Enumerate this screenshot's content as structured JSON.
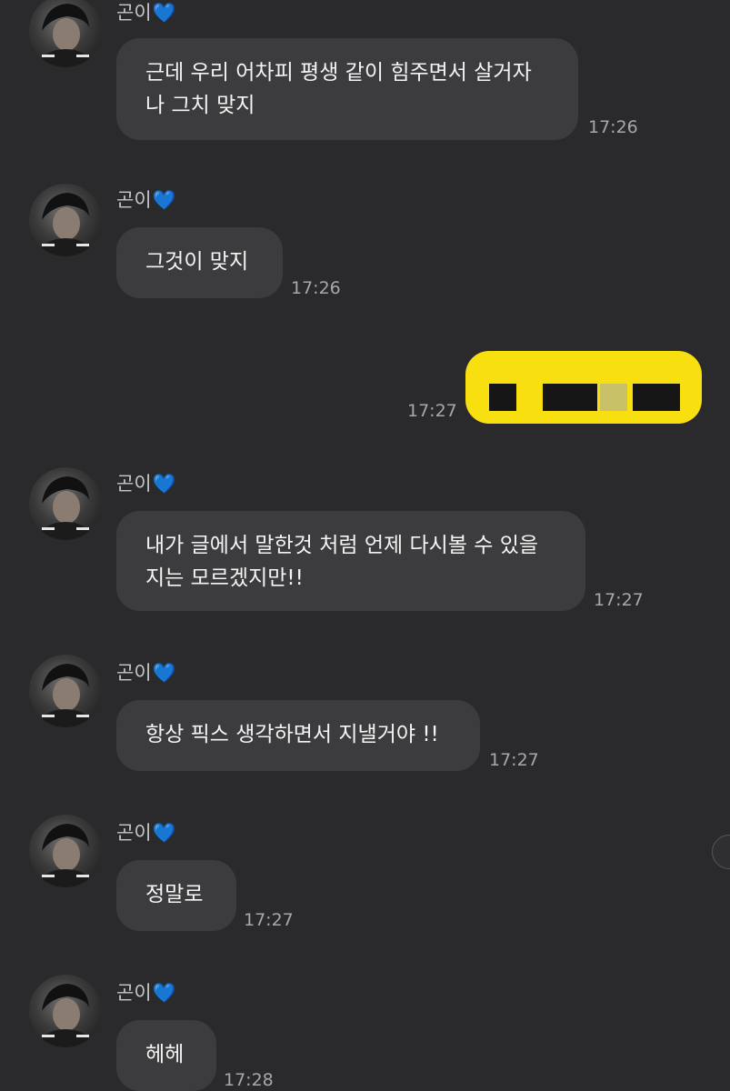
{
  "messages": [
    {
      "sender": "곤이",
      "heart": "💙",
      "lines": [
        "근데 우리 어차피 평생 같이 힘주면서 살거자",
        "나 그치 맞지"
      ],
      "time": "17:26"
    },
    {
      "sender": "곤이",
      "heart": "💙",
      "lines": [
        "그것이 맞지"
      ],
      "time": "17:26"
    },
    {
      "sender": "곤이",
      "heart": "💙",
      "lines": [
        "내가 글에서 말한것 처럼 언제 다시볼 수 있을",
        "지는 모르겠지만!!"
      ],
      "time": "17:27"
    },
    {
      "sender": "곤이",
      "heart": "💙",
      "lines": [
        "항상 픽스 생각하면서 지낼거야 !!"
      ],
      "time": "17:27"
    },
    {
      "sender": "곤이",
      "heart": "💙",
      "lines": [
        "정말로"
      ],
      "time": "17:27"
    },
    {
      "sender": "곤이",
      "heart": "💙",
      "lines": [
        "헤헤"
      ],
      "time": "17:28"
    }
  ],
  "my_message": {
    "time": "17:27",
    "redacted": true
  },
  "colors": {
    "background": "#2a2a2c",
    "incoming_bubble": "#3c3c3e",
    "outgoing_bubble": "#f7df10",
    "heart": "#2f7cff",
    "timestamp": "#a8a8a8"
  },
  "icons": {
    "avatar": "profile-photo-icon",
    "heart": "blue-heart-icon"
  }
}
